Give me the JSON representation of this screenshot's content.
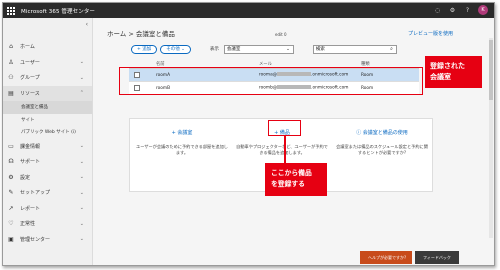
{
  "app": {
    "title": "Microsoft 365 管理センター",
    "avatar_initial": "K",
    "brand_color": "#2b2b2b"
  },
  "top_icons": [
    "notification-icon",
    "settings-icon",
    "help-icon"
  ],
  "sidebar": {
    "items": [
      {
        "label": "ホーム",
        "icon": "home-icon"
      },
      {
        "label": "ユーザー",
        "icon": "user-icon"
      },
      {
        "label": "グループ",
        "icon": "group-icon"
      },
      {
        "label": "リソース",
        "icon": "resources-icon"
      }
    ],
    "sub_items": [
      {
        "label": "会議室と備品"
      },
      {
        "label": "サイト"
      },
      {
        "label": "パブリック Web サイト (i)"
      }
    ],
    "more_items": [
      {
        "label": "課金情報",
        "icon": "billing-icon"
      },
      {
        "label": "サポート",
        "icon": "support-icon"
      },
      {
        "label": "設定",
        "icon": "settings-icon"
      },
      {
        "label": "セットアップ",
        "icon": "setup-icon"
      },
      {
        "label": "レポート",
        "icon": "reports-icon"
      },
      {
        "label": "正常性",
        "icon": "health-icon"
      },
      {
        "label": "管理センター",
        "icon": "admin-centers-icon"
      }
    ]
  },
  "main": {
    "breadcrumb": "ホーム > 会議室と備品",
    "edit_label": "edit 0",
    "preview_link": "プレビュー版を使用",
    "toolbar": {
      "add_button": "+ 追加",
      "more_button": "その他",
      "filter_label": "表示",
      "filter_value": "会議室",
      "search_value": "検索"
    },
    "table": {
      "headers": {
        "name": "名前",
        "mail": "メール",
        "type": "種類"
      },
      "rows": [
        {
          "name": "roomA",
          "mail_prefix": "rooma@",
          "mail_suffix": ".onmicrosoft.com",
          "type": "Room"
        },
        {
          "name": "roomB",
          "mail_prefix": "roomb@",
          "mail_suffix": ".onmicrosoft.com",
          "type": "Room"
        }
      ]
    },
    "panel": {
      "col1_head": "+ 会議室",
      "col1_desc": "ユーザーが会議のために予約できる部屋を追加します。",
      "col2_head": "+ 備品",
      "col2_desc": "自動車やプロジェクターなど、ユーザーが予約できる備品を追加します。",
      "col3_head": "ⓘ 会議室と備品の使用",
      "col3_desc": "会議室または備品のスケジュール設定と予約に関するヒントが必要ですか?"
    },
    "annotations": {
      "room_callout_1": "登録された",
      "room_callout_2": "会議室",
      "equip_callout_1": "ここから備品",
      "equip_callout_2": "を登録する",
      "accent": "#e60012"
    },
    "footer": {
      "help_label": "ヘルプが必要ですか?",
      "chat_label": "フィードバック"
    }
  }
}
